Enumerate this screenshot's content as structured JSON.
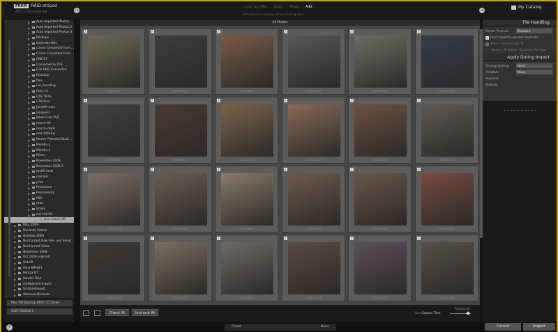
{
  "top": {
    "source_badge": "FROM",
    "source_name": "RAID-striped",
    "source_path": "All / ... / zion-march-09",
    "modes": [
      "Copy as DNG",
      "Copy",
      "Move",
      "Add"
    ],
    "active_mode": "Add",
    "mode_description": "Add photos to catalog without moving them",
    "destination": "My Catalog"
  },
  "tree": [
    {
      "label": "Auto Imported Photos",
      "level": 1
    },
    {
      "label": "Auto Imported Photos-2",
      "level": 1
    },
    {
      "label": "Auto Imported Photos-3",
      "level": 1
    },
    {
      "label": "Backups",
      "level": 1
    },
    {
      "label": "Calendar-Hills",
      "level": 1
    },
    {
      "label": "Canon Converted from ...",
      "level": 1
    },
    {
      "label": "Canon Converted from ...",
      "level": 1
    },
    {
      "label": "CNE-07",
      "level": 1
    },
    {
      "label": "Converted to TIFF",
      "level": 1
    },
    {
      "label": "D3s-DNG-Converted",
      "level": 1
    },
    {
      "label": "Desktop",
      "level": 1
    },
    {
      "label": "files",
      "level": 1
    },
    {
      "label": "For_Blending",
      "level": 1
    },
    {
      "label": "from_c1",
      "level": 1
    },
    {
      "label": "GTB TIFFS",
      "level": 1
    },
    {
      "label": "GTB-files",
      "level": 1
    },
    {
      "label": "June09-nobs",
      "level": 1
    },
    {
      "label": "lasspers1",
      "level": 1
    },
    {
      "label": "Made Final PSD",
      "level": 1
    },
    {
      "label": "march-09",
      "level": 1
    },
    {
      "label": "march-2009",
      "level": 1
    },
    {
      "label": "march09-fuji",
      "level": 1
    },
    {
      "label": "Master Potential Book ...",
      "level": 1
    },
    {
      "label": "Mombo-2",
      "level": 1
    },
    {
      "label": "Mombo-3",
      "level": 1
    },
    {
      "label": "Nikon_",
      "level": 1
    },
    {
      "label": "November 2008",
      "level": 1
    },
    {
      "label": "November 2008-2",
      "level": 1
    },
    {
      "label": "oct09-rieds",
      "level": 1
    },
    {
      "label": "orphans",
      "level": 1
    },
    {
      "label": "print",
      "level": 1
    },
    {
      "label": "Processed",
      "level": 1
    },
    {
      "label": "Processed-2",
      "level": 1
    },
    {
      "label": "PSD",
      "level": 1
    },
    {
      "label": "raws",
      "level": 1
    },
    {
      "label": "Scans",
      "level": 1
    },
    {
      "label": "zion-04-09",
      "level": 1
    },
    {
      "label": "zion-march-09",
      "level": 2,
      "selected": true
    },
    {
      "label": "May_2009",
      "level": 0
    },
    {
      "label": "Musicola Videos",
      "level": 0
    },
    {
      "label": "Namibia-2006",
      "level": 0
    },
    {
      "label": "NonCurrent Raw Files and Shoot...",
      "level": 0
    },
    {
      "label": "NonCurrent Video",
      "level": 0
    },
    {
      "label": "November 2008",
      "level": 0
    },
    {
      "label": "Oct 2008 originals",
      "level": 0
    },
    {
      "label": "Oct-09",
      "level": 0
    },
    {
      "label": "Paris-MP-DF1",
      "level": 0
    },
    {
      "label": "Pentax K7",
      "level": 0
    },
    {
      "label": "Render Files",
      "level": 0
    },
    {
      "label": "S3-Relased Images",
      "level": 0
    },
    {
      "label": "S3-Unreleased",
      "level": 0
    },
    {
      "label": "Alamosa-Musicola",
      "level": 0
    }
  ],
  "volumes": [
    "Mac HD Backup With CCCloner",
    "OWC-500GB-1"
  ],
  "left_info": [
    "27 photos",
    "73 GB"
  ],
  "grid": {
    "title": "All Photos",
    "filenames": [
      "CF000032.tif",
      "CF000061.tif",
      "CF000166.tif",
      "CF000163.tif",
      "CF000163.tif",
      "CF000171.tif",
      "CF000194.tif",
      "CF000401.tif",
      "CF000111.tif",
      "CF000420.tif",
      "CF000487.tif",
      "CF000444.tif",
      "CF000477.tif",
      "CF000440.tif",
      "CF000468.tif",
      "CF000470.tif",
      "CF000461.tif",
      "CF000453.tif",
      "CF000507.tif",
      "CF000543.tif",
      "CF000548.tif",
      "CF000511.tif",
      "CF000513.tif",
      "CF000514.tif"
    ]
  },
  "grid_bottom": {
    "check_all": "Check All",
    "uncheck_all": "Uncheck All",
    "sort_label": "Sort",
    "sort_value": "Capture Time",
    "thumbnails_label": "Thumbnails"
  },
  "panels": {
    "file_handling": {
      "title": "File Handling",
      "render_label": "Render Previews",
      "render_value": "Standard",
      "dont_import": "Don't Import Suspected Duplicates",
      "second_copy": "Make a Second Copy To :",
      "second_copy_path": "/Users/.../Dropbox/...Download Backups"
    },
    "apply": {
      "title": "Apply During Import",
      "develop_label": "Develop Settings",
      "develop_value": "None",
      "metadata_label": "Metadata",
      "metadata_value": "None",
      "keywords_label": "Keywords",
      "keywords_value": "Musicola"
    }
  },
  "bottom": {
    "preset_label": "Preset :",
    "preset_value": "None",
    "cancel": "Cancel",
    "import": "Import"
  }
}
